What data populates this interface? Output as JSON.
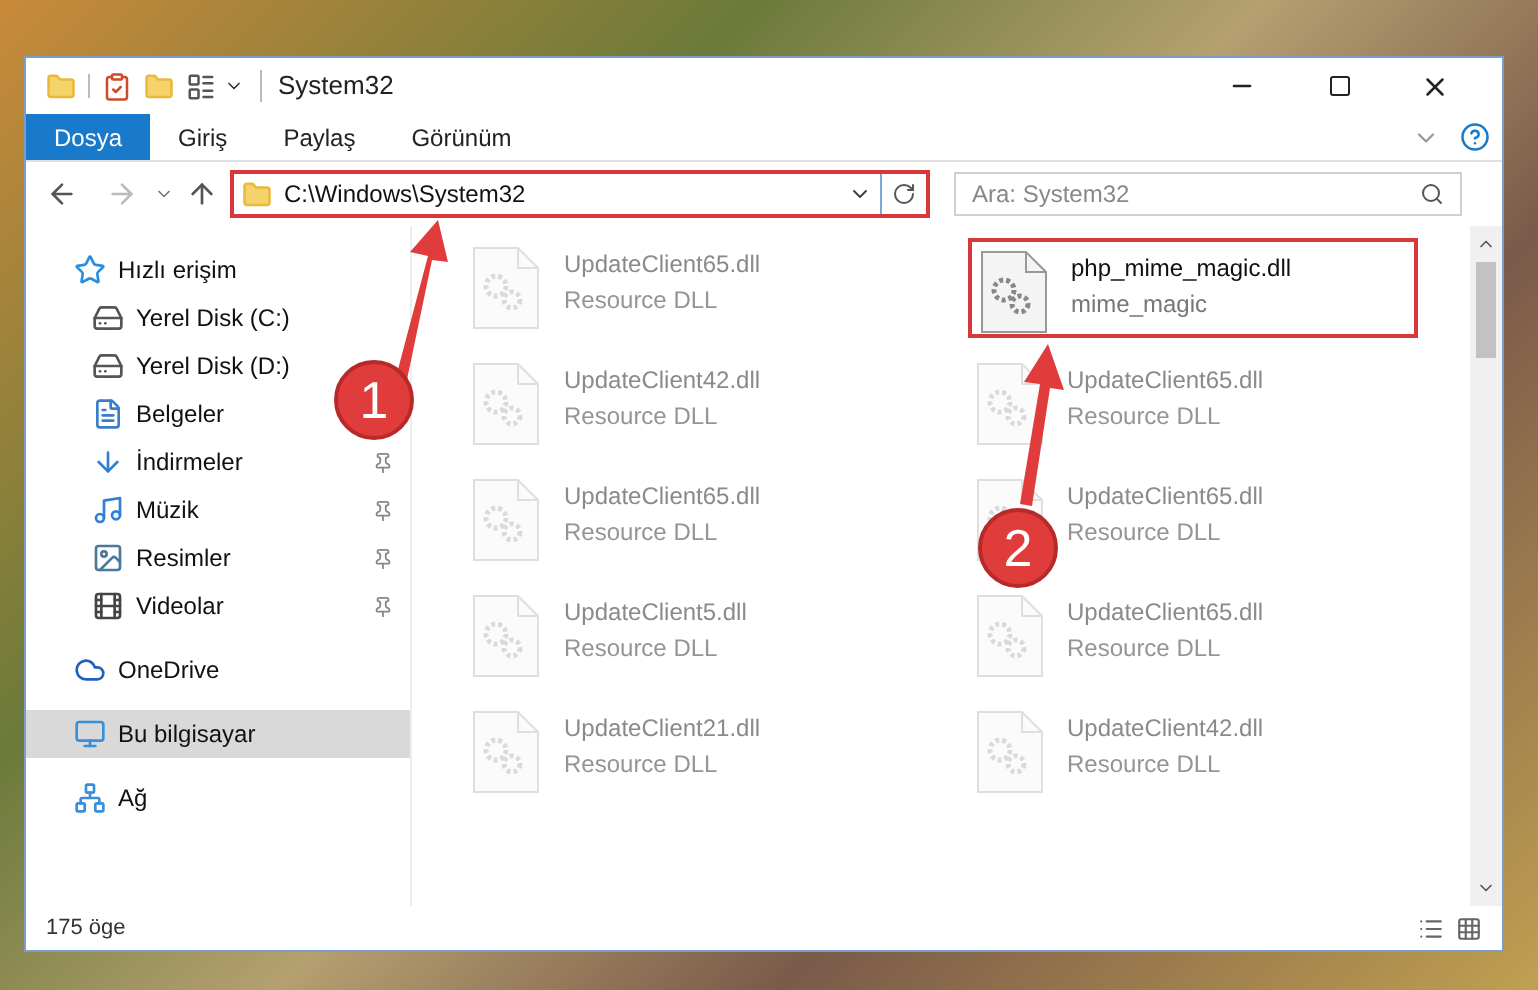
{
  "window": {
    "title": "System32"
  },
  "ribbon_tabs": [
    {
      "label": "Dosya",
      "selected": true
    },
    {
      "label": "Giriş",
      "selected": false
    },
    {
      "label": "Paylaş",
      "selected": false
    },
    {
      "label": "Görünüm",
      "selected": false
    }
  ],
  "address_bar": {
    "value": "C:\\Windows\\System32"
  },
  "search": {
    "placeholder": "Ara: System32"
  },
  "sidebar": {
    "items": [
      {
        "label": "Hızlı erişim",
        "selected": false,
        "children": [
          {
            "label": "Yerel Disk (C:)",
            "pinned": false
          },
          {
            "label": "Yerel Disk (D:)",
            "pinned": false
          },
          {
            "label": "Belgeler",
            "pinned": false
          },
          {
            "label": "İndirmeler",
            "pinned": true
          },
          {
            "label": "Müzik",
            "pinned": true
          },
          {
            "label": "Resimler",
            "pinned": true
          },
          {
            "label": "Videolar",
            "pinned": true
          }
        ]
      },
      {
        "label": "OneDrive",
        "selected": false
      },
      {
        "label": "Bu bilgisayar",
        "selected": true
      },
      {
        "label": "Ağ",
        "selected": false
      }
    ]
  },
  "files": [
    {
      "name": "UpdateClient65.dll",
      "type": "Resource DLL",
      "faded": true
    },
    {
      "name": "php_mime_magic.dll",
      "type": "mime_magic",
      "faded": false
    },
    {
      "name": "UpdateClient42.dll",
      "type": "Resource DLL",
      "faded": true
    },
    {
      "name": "UpdateClient65.dll",
      "type": "Resource DLL",
      "faded": true
    },
    {
      "name": "UpdateClient65.dll",
      "type": "Resource DLL",
      "faded": true
    },
    {
      "name": "UpdateClient65.dll",
      "type": "Resource DLL",
      "faded": true
    },
    {
      "name": "UpdateClient5.dll",
      "type": "Resource DLL",
      "faded": true
    },
    {
      "name": "UpdateClient65.dll",
      "type": "Resource DLL",
      "faded": true
    },
    {
      "name": "UpdateClient21.dll",
      "type": "Resource DLL",
      "faded": true
    },
    {
      "name": "UpdateClient42.dll",
      "type": "Resource DLL",
      "faded": true
    }
  ],
  "status_bar": {
    "item_count": "175 öge"
  },
  "annotations": [
    {
      "label": "1"
    },
    {
      "label": "2"
    }
  ]
}
